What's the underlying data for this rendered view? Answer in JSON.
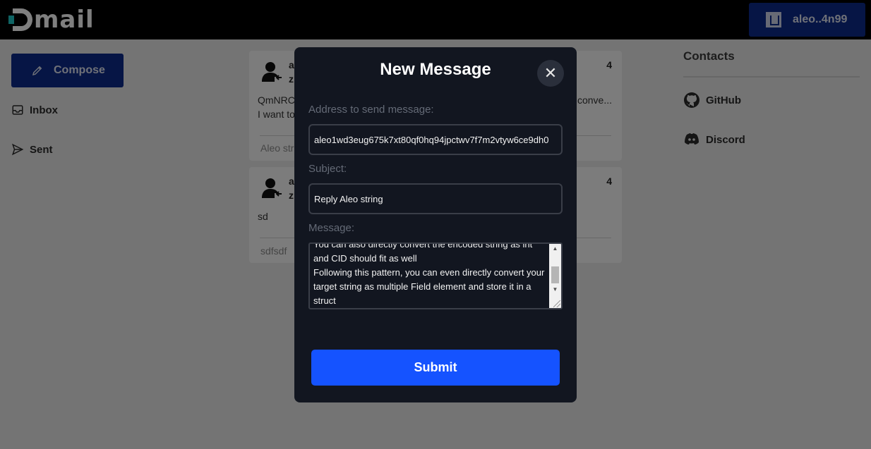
{
  "header": {
    "logo_text": "mail",
    "account_label": "aleo..4n99"
  },
  "sidebar": {
    "compose_label": "Compose",
    "items": [
      {
        "label": "Inbox",
        "icon": "inbox-icon"
      },
      {
        "label": "Sent",
        "icon": "send-icon"
      }
    ]
  },
  "mails": [
    {
      "sender": "a",
      "sender_line2": "z",
      "time": "4",
      "body_line1": "QmNRC",
      "body_line1_right": "conve...",
      "body_line2": "I want to",
      "subject": "Aleo str"
    },
    {
      "sender": "a",
      "sender_line2": "z",
      "time": "4",
      "body_line1": "sd",
      "body_line1_right": "",
      "body_line2": "",
      "subject": "sdfsdf"
    }
  ],
  "contacts": {
    "title": "Contacts",
    "items": [
      {
        "label": "GitHub",
        "icon": "github-icon"
      },
      {
        "label": "Discord",
        "icon": "discord-icon"
      }
    ]
  },
  "modal": {
    "title": "New Message",
    "address_label": "Address to send message:",
    "address_value": "aleo1wd3eug675k7xt80qf0hq94jpctwv7f7m2vtyw6ce9dh0",
    "subject_label": "Subject:",
    "subject_value": "Reply Aleo string",
    "message_label": "Message:",
    "message_lines": [
      "You can also directly convert the encoded string as int",
      "and CID should fit as well",
      "Following this pattern, you can even directly convert your",
      "target string as multiple Field element and store it in a",
      "struct"
    ],
    "submit_label": "Submit"
  },
  "colors": {
    "brand_blue": "#0d2b8a",
    "submit_blue": "#1553ff",
    "modal_bg": "#121620",
    "logo_accent": "#1ec8c8"
  }
}
